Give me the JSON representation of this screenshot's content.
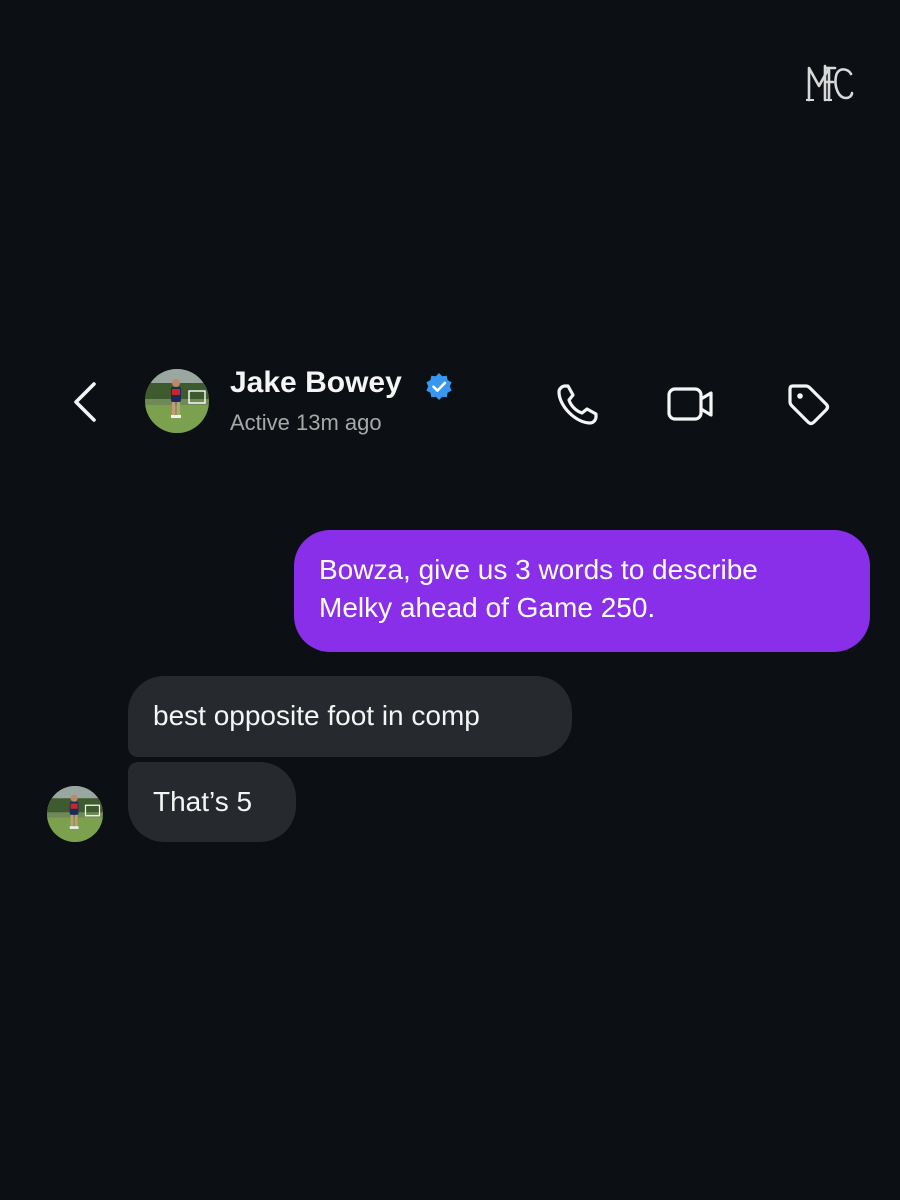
{
  "header": {
    "contact_name": "Jake Bowey",
    "status": "Active 13m ago",
    "icons": {
      "back": "chevron-left-icon",
      "verified": "verified-badge-icon",
      "call": "phone-icon",
      "video": "video-camera-icon",
      "tag": "tag-icon"
    }
  },
  "watermark": {
    "icon": "club-monogram-logo"
  },
  "messages": [
    {
      "direction": "sent",
      "lines": [
        "Bowza, give us 3 words to describe",
        "Melky ahead of Game 250."
      ]
    },
    {
      "direction": "received",
      "text": "best opposite foot in comp"
    },
    {
      "direction": "received",
      "text": "That’s 5"
    }
  ],
  "colors": {
    "background": "#0c1014",
    "sent_bubble": "#8a2fe9",
    "received_bubble": "#262a2e",
    "verified_badge": "#3897f0",
    "status_text": "#a8a8a8"
  }
}
